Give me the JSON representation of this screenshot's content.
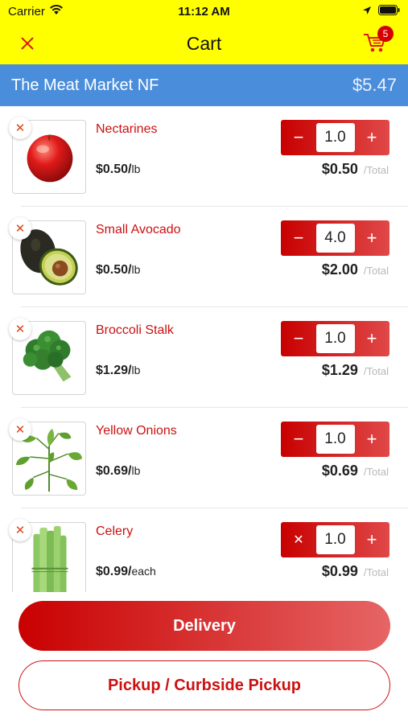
{
  "status_bar": {
    "carrier": "Carrier",
    "time": "11:12 AM"
  },
  "nav": {
    "title": "Cart",
    "cart_count": "5"
  },
  "store": {
    "name": "The Meat Market NF",
    "total": "$5.47"
  },
  "items": [
    {
      "name": "Nectarines",
      "price": "$0.50/",
      "unit": "lb",
      "qty": "1.0",
      "total": "$0.50",
      "total_suffix": "/Total",
      "decrement_icon": "minus-icon",
      "image": "nectarine"
    },
    {
      "name": "Small Avocado",
      "price": "$0.50/",
      "unit": "lb",
      "qty": "4.0",
      "total": "$2.00",
      "total_suffix": "/Total",
      "decrement_icon": "minus-icon",
      "image": "avocado"
    },
    {
      "name": "Broccoli Stalk",
      "price": "$1.29/",
      "unit": "lb",
      "qty": "1.0",
      "total": "$1.29",
      "total_suffix": "/Total",
      "decrement_icon": "minus-icon",
      "image": "broccoli"
    },
    {
      "name": "Yellow Onions",
      "price": "$0.69/",
      "unit": "lb",
      "qty": "1.0",
      "total": "$0.69",
      "total_suffix": "/Total",
      "decrement_icon": "minus-icon",
      "image": "leaves"
    },
    {
      "name": "Celery",
      "price": "$0.99/",
      "unit": "each",
      "qty": "1.0",
      "total": "$0.99",
      "total_suffix": "/Total",
      "decrement_icon": "remove-x-icon",
      "image": "celery"
    }
  ],
  "buttons": {
    "delivery": "Delivery",
    "pickup": "Pickup / Curbside Pickup"
  },
  "colors": {
    "header_yellow": "#ffff00",
    "store_blue": "#4a8ddb",
    "accent_red": "#cc1111"
  }
}
